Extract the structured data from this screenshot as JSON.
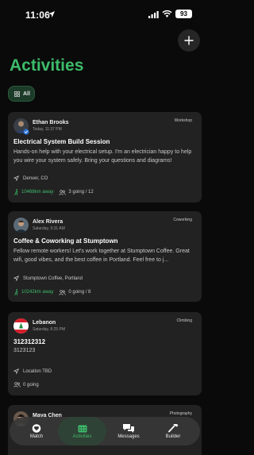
{
  "status_bar": {
    "time": "11:06",
    "battery": "93"
  },
  "header": {
    "title": "Activities"
  },
  "filters": [
    {
      "label": "All",
      "selected": true
    }
  ],
  "cards": [
    {
      "host": "Ethan Brooks",
      "when": "Today, 11:37 PM",
      "category": "Workshop",
      "title": "Electrical System Build Session",
      "description": "Hands-on help with your electrical setup. I'm an electrician happy to help you wire your system safely. Bring your questions and diagrams!",
      "location": "Denver, CO",
      "distance": "10468km away",
      "going": "3 going / 12"
    },
    {
      "host": "Alex Rivera",
      "when": "Saturday, 9:31 AM",
      "category": "Coworking",
      "title": "Coffee & Coworking at Stumptown",
      "description": "Fellow remote workers! Let's work together at Stumptown Coffee. Great wifi, good vibes, and the best coffee in Portland. Feel free to j...",
      "location": "Stumptown Coffee, Portland",
      "distance": "10242km away",
      "going": "0 going / 8"
    },
    {
      "host": "Lebanon",
      "when": "Saturday, 8:25 PM",
      "category": "Climbing",
      "title": "312312312",
      "description": "3123123",
      "location": "Location TBD",
      "going": "0 going"
    },
    {
      "host": "Maya Chen",
      "category": "Photography"
    }
  ],
  "nav": [
    {
      "label": "Match",
      "icon": "heart-icon"
    },
    {
      "label": "Activities",
      "icon": "calendar-icon",
      "active": true
    },
    {
      "label": "Messages",
      "icon": "chat-bubbles-icon"
    },
    {
      "label": "Builder",
      "icon": "hammer-icon"
    }
  ],
  "colors": {
    "accent": "#3dbb6a",
    "card": "#222222",
    "background": "#0a0a0a"
  }
}
